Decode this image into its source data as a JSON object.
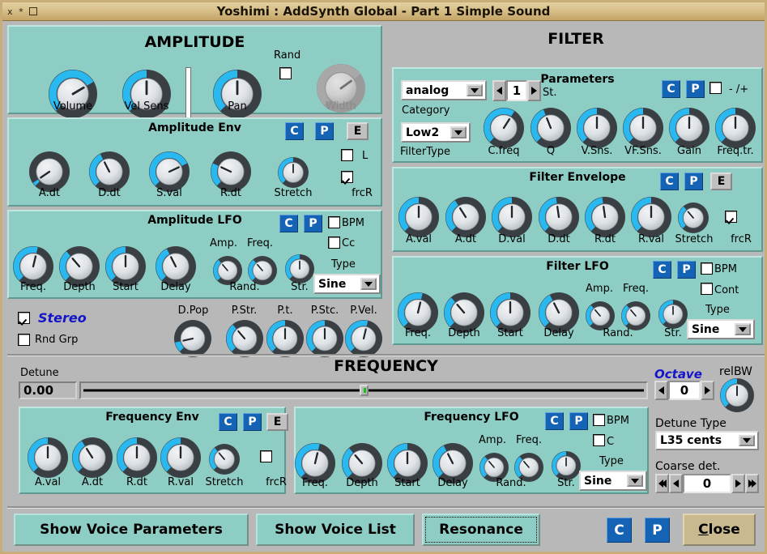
{
  "window": {
    "title": "Yoshimi : AddSynth Global - Part 1 Simple Sound",
    "close_glyph": "x",
    "min_glyph": "*",
    "max_glyph": "□"
  },
  "amplitude": {
    "title": "AMPLITUDE",
    "knobs": [
      {
        "label": "Volume",
        "value": 72
      },
      {
        "label": "Vel Sens",
        "value": 50
      },
      {
        "label": "Pan",
        "value": 50
      }
    ],
    "rand_label": "Rand",
    "rand_checked": false,
    "width_knob": {
      "label": "Width",
      "value": 70,
      "disabled": true
    },
    "env": {
      "title": "Amplitude Env",
      "copy": "C",
      "paste": "P",
      "edit": "E",
      "l_label": "L",
      "l_checked": false,
      "frcr_label": "frcR",
      "frcr_checked": true,
      "knobs": [
        {
          "label": "A.dt",
          "value": 4
        },
        {
          "label": "D.dt",
          "value": 40
        },
        {
          "label": "S.val",
          "value": 74
        },
        {
          "label": "R.dt",
          "value": 26
        },
        {
          "label": "Stretch",
          "value": 50
        }
      ]
    },
    "lfo": {
      "title": "Amplitude LFO",
      "copy": "C",
      "paste": "P",
      "bpm_label": "BPM",
      "bpm_checked": false,
      "cc_label": "Cc",
      "cc_checked": false,
      "amp_label": "Amp.",
      "freq_label": "Freq.",
      "type_label": "Type",
      "type_value": "Sine",
      "knobs": [
        {
          "label": "Freq.",
          "value": 55
        },
        {
          "label": "Depth",
          "value": 35
        },
        {
          "label": "Start",
          "value": 50
        },
        {
          "label": "Delay",
          "value": 40
        }
      ],
      "small_knobs": [
        {
          "label": "Rand.",
          "value": 35
        },
        {
          "label": "",
          "value": 35
        }
      ],
      "str_knob": {
        "label": "Str.",
        "value": 50
      }
    },
    "stereo_label": "Stereo",
    "stereo_checked": true,
    "rndgrp_label": "Rnd Grp",
    "rndgrp_checked": false,
    "pot_knobs": [
      {
        "label": "D.Pop",
        "value": 12
      },
      {
        "label": "P.Str.",
        "value": 35
      },
      {
        "label": "P.t.",
        "value": 50
      },
      {
        "label": "P.Stc.",
        "value": 50
      },
      {
        "label": "P.Vel.",
        "value": 55
      }
    ]
  },
  "filter": {
    "title": "FILTER",
    "params": {
      "title": "Parameters",
      "category_value": "analog",
      "category_label": "Category",
      "filtertype_value": "Low2",
      "filtertype_label": "FilterType",
      "stages_value": "1",
      "stages_label": "St.",
      "copy": "C",
      "paste": "P",
      "pm_label": "- /+",
      "pm_checked": false,
      "knobs": [
        {
          "label": "C.freq",
          "value": 62
        },
        {
          "label": "Q",
          "value": 42
        },
        {
          "label": "V.Sns.",
          "value": 50
        },
        {
          "label": "VF.Sns.",
          "value": 50
        },
        {
          "label": "Gain",
          "value": 50
        },
        {
          "label": "Freq.tr.",
          "value": 50
        }
      ]
    },
    "env": {
      "title": "Filter Envelope",
      "copy": "C",
      "paste": "P",
      "edit": "E",
      "frcr_label": "frcR",
      "frcr_checked": true,
      "knobs": [
        {
          "label": "A.val",
          "value": 50
        },
        {
          "label": "A.dt",
          "value": 38
        },
        {
          "label": "D.val",
          "value": 50
        },
        {
          "label": "D.dt",
          "value": 47
        },
        {
          "label": "R.dt",
          "value": 47
        },
        {
          "label": "R.val",
          "value": 50
        },
        {
          "label": "Stretch",
          "value": 35
        }
      ]
    },
    "lfo": {
      "title": "Filter LFO",
      "copy": "C",
      "paste": "P",
      "bpm_label": "BPM",
      "bpm_checked": false,
      "cont_label": "Cont",
      "cont_checked": false,
      "amp_label": "Amp.",
      "freq_label": "Freq.",
      "type_label": "Type",
      "type_value": "Sine",
      "knobs": [
        {
          "label": "Freq.",
          "value": 55
        },
        {
          "label": "Depth",
          "value": 35
        },
        {
          "label": "Start",
          "value": 50
        },
        {
          "label": "Delay",
          "value": 40
        }
      ],
      "small_knobs": [
        {
          "label": "Rand.",
          "value": 35
        },
        {
          "label": "",
          "value": 35
        }
      ],
      "str_knob": {
        "label": "Str.",
        "value": 50
      }
    }
  },
  "frequency": {
    "title": "FREQUENCY",
    "detune_label": "Detune",
    "detune_value": "0.00",
    "detune_slider_pct": 50,
    "octave_label": "Octave",
    "octave_value": "0",
    "relbw_label": "relBW",
    "relbw_value": 50,
    "detune_type_label": "Detune Type",
    "detune_type_value": "L35 cents",
    "coarse_label": "Coarse det.",
    "coarse_value": "0",
    "env": {
      "title": "Frequency Env",
      "copy": "C",
      "paste": "P",
      "edit": "E",
      "frcr_label": "frcR",
      "frcr_checked": false,
      "knobs": [
        {
          "label": "A.val",
          "value": 50
        },
        {
          "label": "A.dt",
          "value": 38
        },
        {
          "label": "R.dt",
          "value": 50
        },
        {
          "label": "R.val",
          "value": 50
        },
        {
          "label": "Stretch",
          "value": 35
        }
      ]
    },
    "lfo": {
      "title": "Frequency LFO",
      "copy": "C",
      "paste": "P",
      "bpm_label": "BPM",
      "bpm_checked": false,
      "c_label": "C",
      "c_checked": false,
      "amp_label": "Amp.",
      "freq_label": "Freq.",
      "type_label": "Type",
      "type_value": "Sine",
      "knobs": [
        {
          "label": "Freq.",
          "value": 55
        },
        {
          "label": "Depth",
          "value": 35
        },
        {
          "label": "Start",
          "value": 50
        },
        {
          "label": "Delay",
          "value": 40
        }
      ],
      "small_knobs": [
        {
          "label": "Rand.",
          "value": 35
        },
        {
          "label": "",
          "value": 35
        }
      ],
      "str_knob": {
        "label": "Str.",
        "value": 50
      }
    }
  },
  "footer": {
    "show_voice_parameters": "Show Voice Parameters",
    "show_voice_list": "Show Voice List",
    "resonance": "Resonance",
    "copy": "C",
    "paste": "P",
    "close": "Close"
  },
  "colors": {
    "teal_panel": "#8ecdc4",
    "grey_bg": "#b8b8b8",
    "accent_blue": "#1463b4",
    "knob_arc": "#29b8ef",
    "title_gold": "#d9c28c"
  }
}
